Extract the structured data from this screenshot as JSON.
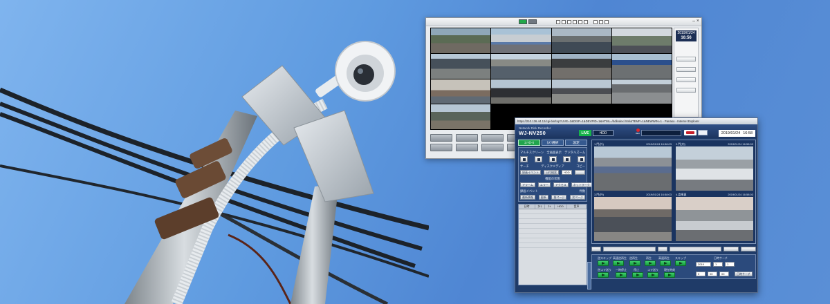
{
  "viewer": {
    "date": "2019/01/24",
    "time": "16:56",
    "window_controls": "–  ×"
  },
  "recorder": {
    "address_bar": "https://210.136.44.12/cgi-bin/top?LIVE=1&DISP=1&DEVPID=1&HTML=/hdlindex.html&TEMP=1&NEWWIN=1 - Panaso - Internet Explorer",
    "model_small": "Network Disk Recorder",
    "model": "WJ-NV250",
    "live_label": "LIVE",
    "hdd_label": "HDD",
    "rec_label": "REC",
    "clock_date": "2019/01/24",
    "clock_time": "16:58",
    "tabs": [
      "ｺﾝﾄﾛｰﾙ",
      "ｶﾒﾗ選択",
      "設定"
    ],
    "labels": {
      "multiscreen": "マルチスクリーン",
      "fullscreen": "全画面表示",
      "digital_zoom": "デジタルズーム",
      "search": "サーチ",
      "disk": "ディスクメディア",
      "copy": "コピー",
      "status": "機能の状態",
      "recent_events": "録画イベント",
      "count": "件数"
    },
    "buttons": {
      "search_event": "録画イベント",
      "search_date": "日付検索",
      "alarm": "アラーム",
      "error": "エラー",
      "access": "アクセス",
      "network": "ネットワーク",
      "refresh": "最新情報",
      "reset": "更新",
      "prev_page": "前ページ",
      "next_page": "次ページ",
      "date_search": "日時サーチ",
      "play_back": "停止"
    },
    "disk_select": "HDD",
    "columns": [
      "日時",
      "ｶﾒﾗ",
      "ﾁｬ",
      "HDD",
      "音声"
    ],
    "cameras": [
      {
        "title": "1.門(外)",
        "stamp": "2019/01/24 16:58:03"
      },
      {
        "title": "2.門(内)",
        "stamp": "2019/01/24 16:58:03"
      },
      {
        "title": "3.門(外)",
        "stamp": "2019/01/24 16:58:03"
      },
      {
        "title": "4.倉庫裏",
        "stamp": "2019/01/24 16:58:03"
      }
    ],
    "playback": {
      "labels": [
        "逆スキップ",
        "高速逆再生",
        "逆再生",
        "再生",
        "高速再生",
        "スキップ"
      ],
      "labels2": [
        "逆コマ送り",
        "一時停止",
        "停止",
        "コマ送り",
        "現在時刻"
      ],
      "date_search_label": "日時サーチ",
      "year": "2019",
      "month": "1",
      "day": "1",
      "hour": "0",
      "minute": "00",
      "second": "00"
    }
  }
}
